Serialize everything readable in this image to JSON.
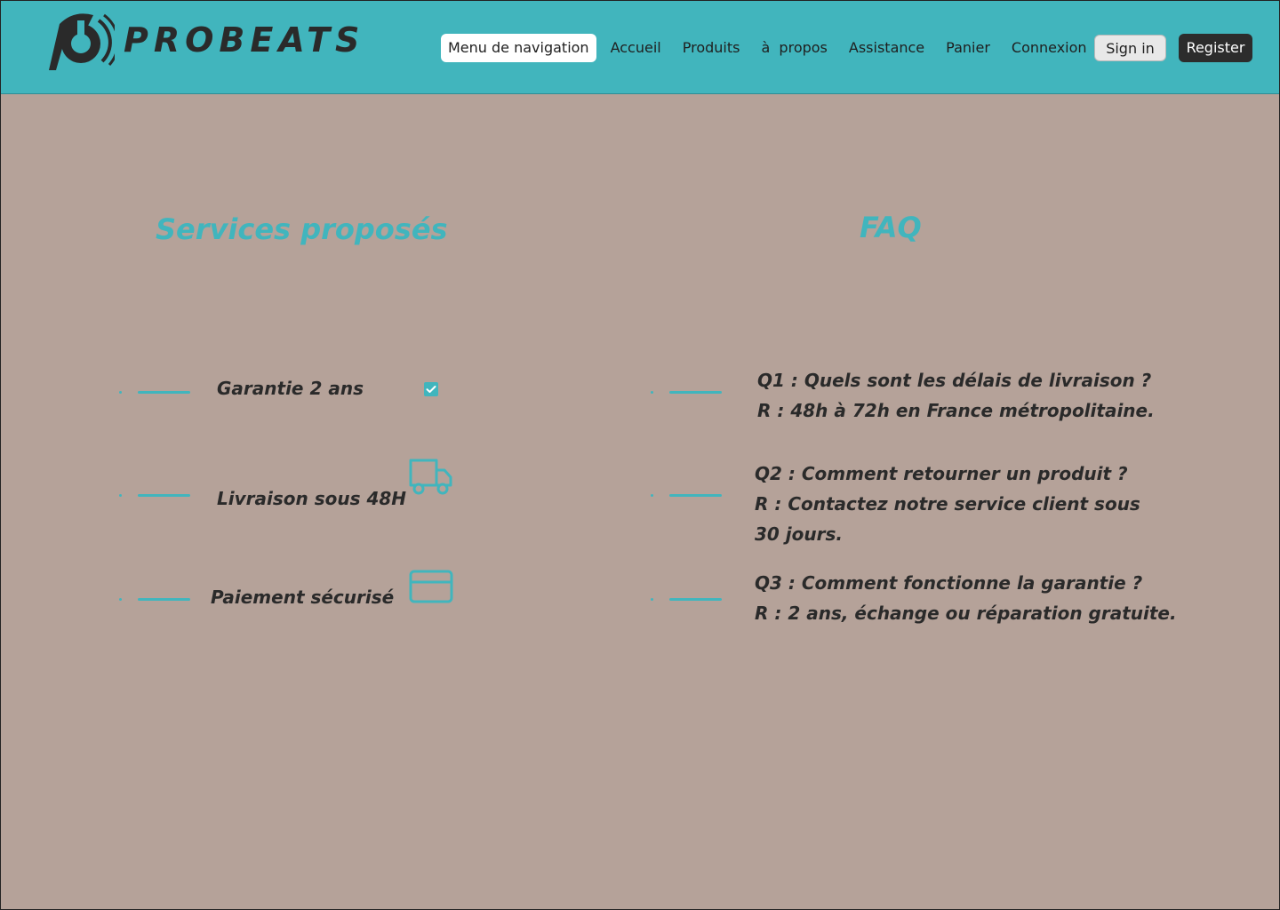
{
  "brand": {
    "name": "PROBEATS",
    "icon": "probeats-logo-icon"
  },
  "nav": {
    "items": [
      {
        "label": "Menu de navigation",
        "active": true
      },
      {
        "label": "Accueil"
      },
      {
        "label": "Produits"
      },
      {
        "label": "à  propos"
      },
      {
        "label": "Assistance"
      },
      {
        "label": "Panier"
      },
      {
        "label": "Connexion"
      }
    ],
    "signin_label": "Sign in",
    "register_label": "Register"
  },
  "services": {
    "title": "Services proposés",
    "items": [
      {
        "label": "Garantie 2 ans",
        "icon": "checkbox-checked-icon"
      },
      {
        "label": "Livraison sous 48H",
        "icon": "truck-icon"
      },
      {
        "label": "Paiement sécurisé",
        "icon": "credit-card-icon"
      }
    ]
  },
  "faq": {
    "title": "FAQ",
    "items": [
      {
        "question": "Q1 : Quels sont les délais de livraison ?",
        "answer": "R : 48h à 72h en France métropolitaine."
      },
      {
        "question": "Q2 : Comment retourner un produit ?",
        "answer": "R : Contactez notre service client sous 30 jours."
      },
      {
        "question": "Q3 : Comment fonctionne la garantie ?",
        "answer": "R : 2 ans, échange ou réparation gratuite."
      }
    ]
  },
  "colors": {
    "accent": "#41b5bd",
    "background": "#b5a299",
    "text": "#2a2a2a",
    "register_bg": "#2c2c2c"
  }
}
